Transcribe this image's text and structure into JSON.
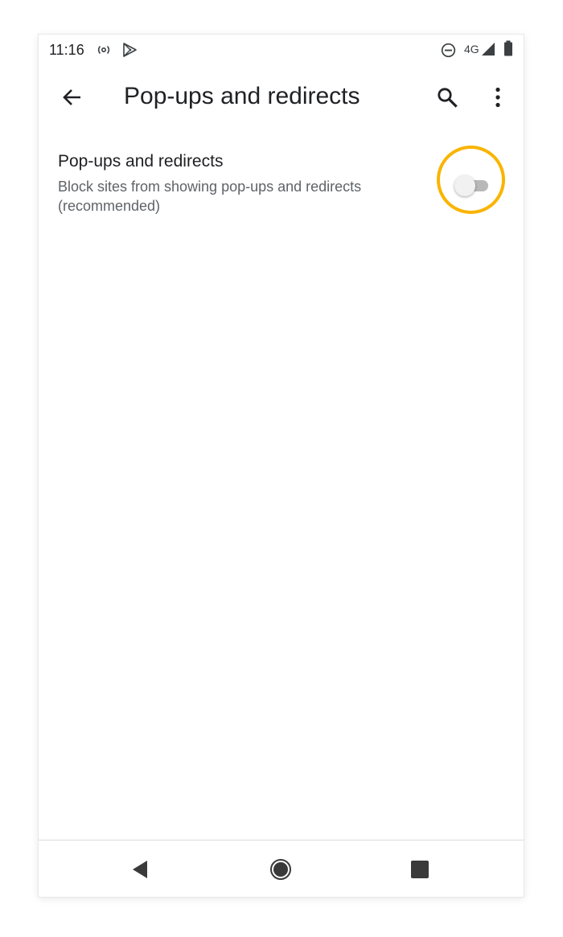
{
  "status_bar": {
    "time": "11:16",
    "network": "4G",
    "icons": [
      "hotspot-icon",
      "play-store-icon",
      "do-not-disturb-icon",
      "signal-icon",
      "battery-icon"
    ]
  },
  "app_bar": {
    "title": "Pop-ups and redirects",
    "icons": [
      "back-arrow-icon",
      "search-icon",
      "more-vert-icon"
    ]
  },
  "setting": {
    "title": "Pop-ups and redirects",
    "description": "Block sites from showing pop-ups and redirects (recommended)",
    "toggle_on": false
  },
  "highlight_color": "#f9b400",
  "nav_bar": {
    "icons": [
      "nav-back-icon",
      "nav-home-icon",
      "nav-recents-icon"
    ]
  }
}
